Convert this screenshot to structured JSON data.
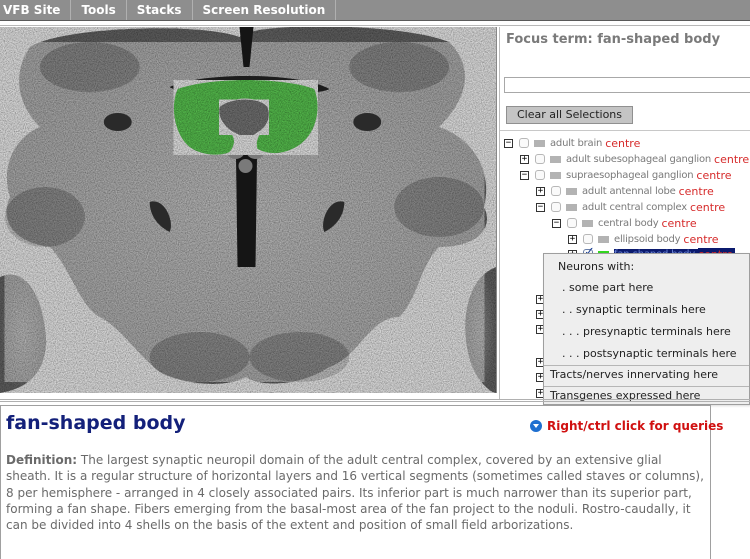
{
  "menubar": {
    "items": [
      "VFB Site",
      "Tools",
      "Stacks",
      "Screen Resolution"
    ]
  },
  "viewer": {
    "highlight_color": "#3fd22a",
    "highlighted_region": "fan-shaped body"
  },
  "right_panel": {
    "focus_label": "Focus term: fan-shaped body",
    "search_value": "",
    "clear_button": "Clear all Selections",
    "tree": [
      {
        "label": "adult brain",
        "link": "centre",
        "toggle": "minus",
        "checked": false,
        "swatch": "#b3b3b3",
        "depth": 0
      },
      {
        "label": "adult subesophageal ganglion",
        "link": "centre",
        "toggle": "plus",
        "checked": false,
        "swatch": "#b3b3b3",
        "depth": 1
      },
      {
        "label": "supraesophageal ganglion",
        "link": "centre",
        "toggle": "minus",
        "checked": false,
        "swatch": "#b3b3b3",
        "depth": 1
      },
      {
        "label": "adult antennal lobe",
        "link": "centre",
        "toggle": "plus",
        "checked": false,
        "swatch": "#b3b3b3",
        "depth": 2
      },
      {
        "label": "adult central complex",
        "link": "centre",
        "toggle": "minus",
        "checked": false,
        "swatch": "#b3b3b3",
        "depth": 2
      },
      {
        "label": "central body",
        "link": "centre",
        "toggle": "minus",
        "checked": false,
        "swatch": "#b3b3b3",
        "depth": 3
      },
      {
        "label": "ellipsoid body",
        "link": "centre",
        "toggle": "plus",
        "checked": false,
        "swatch": "#b3b3b3",
        "depth": 4
      },
      {
        "label": "fan-shaped body",
        "link": "centre",
        "toggle": "plus",
        "checked": true,
        "swatch": "#33d61f",
        "depth": 4,
        "selected": true
      }
    ]
  },
  "context_menu": {
    "heading": "Neurons with:",
    "items": [
      ". some part here",
      ". . synaptic terminals here",
      ". . . presynaptic terminals here",
      ". . . postsynaptic terminals here",
      "Tracts/nerves innervating here",
      "Transgenes expressed here"
    ]
  },
  "definition_panel": {
    "term": "fan-shaped body",
    "query_hint": "Right/ctrl click for queries",
    "definition_label": "Definition:",
    "definition_text": "The largest synaptic neuropil domain of the adult central complex, covered by an extensive glial sheath. It is a regular structure of horizontal layers and 16 vertical segments (sometimes called staves or columns), 8 per hemisphere - arranged in 4 closely associated pairs. Its inferior part is much narrower than its superior part, forming a fan shape. Fibers emerging from the basal-most area of the fan project to the noduli. Rostro-caudally, it can be divided into 4 shells on the basis of the extent and position of small field arborizations."
  },
  "colors": {
    "menubar_bg": "#8e8e8e",
    "link_red": "#d62a2a",
    "title_navy": "#13207a",
    "query_red": "#d01010",
    "selection_bg": "#0b1a6e"
  }
}
